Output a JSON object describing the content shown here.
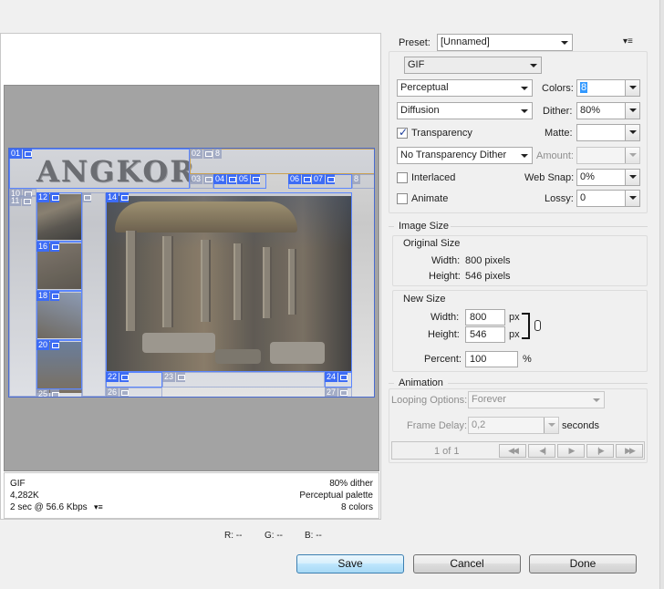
{
  "preview": {
    "logo_text": "ANGKOR",
    "slices": {
      "s01": "01",
      "s02": "02",
      "s03": "03",
      "s04": "04",
      "s05": "05",
      "s06": "06",
      "s07": "07",
      "s11": "11",
      "s12": "12",
      "s14": "14",
      "s16": "16",
      "s18": "18",
      "s20": "20",
      "s22": "22",
      "s23": "23",
      "s24": "24",
      "s25": "25",
      "s26": "26",
      "s27": "27",
      "s10": "10",
      "s08": "8"
    },
    "status": {
      "format": "GIF",
      "size": "4,282K",
      "download_time": "2 sec @ 56.6 Kbps",
      "dither": "80% dither",
      "palette": "Perceptual palette",
      "colors": "8 colors"
    },
    "rgb": {
      "r": "R: --",
      "g": "G: --",
      "b": "B: --"
    }
  },
  "settings": {
    "preset_label": "Preset:",
    "preset_value": "[Unnamed]",
    "format_value": "GIF",
    "reduction_value": "Perceptual",
    "colors_label": "Colors:",
    "colors_value": "8",
    "dither_algo_value": "Diffusion",
    "dither_label": "Dither:",
    "dither_value": "80%",
    "transparency_label": "Transparency",
    "matte_label": "Matte:",
    "transparency_dither_value": "No Transparency Dither",
    "amount_label": "Amount:",
    "interlaced_label": "Interlaced",
    "web_snap_label": "Web Snap:",
    "web_snap_value": "0%",
    "animate_label": "Animate",
    "lossy_label": "Lossy:",
    "lossy_value": "0"
  },
  "image_size": {
    "section_label": "Image Size",
    "original_label": "Original Size",
    "orig_width_label": "Width:",
    "orig_width_value": "800 pixels",
    "orig_height_label": "Height:",
    "orig_height_value": "546 pixels",
    "new_label": "New Size",
    "width_label": "Width:",
    "width_value": "800",
    "height_label": "Height:",
    "height_value": "546",
    "px_unit_w": "px",
    "px_unit_h": "px",
    "percent_label": "Percent:",
    "percent_value": "100",
    "percent_unit": "%"
  },
  "animation": {
    "section_label": "Animation",
    "looping_label": "Looping Options:",
    "looping_value": "Forever",
    "frame_delay_label": "Frame Delay:",
    "frame_delay_value": "0,2",
    "seconds_label": "seconds",
    "frame_counter": "1 of 1"
  },
  "buttons": {
    "save": "Save",
    "cancel": "Cancel",
    "done": "Done"
  }
}
